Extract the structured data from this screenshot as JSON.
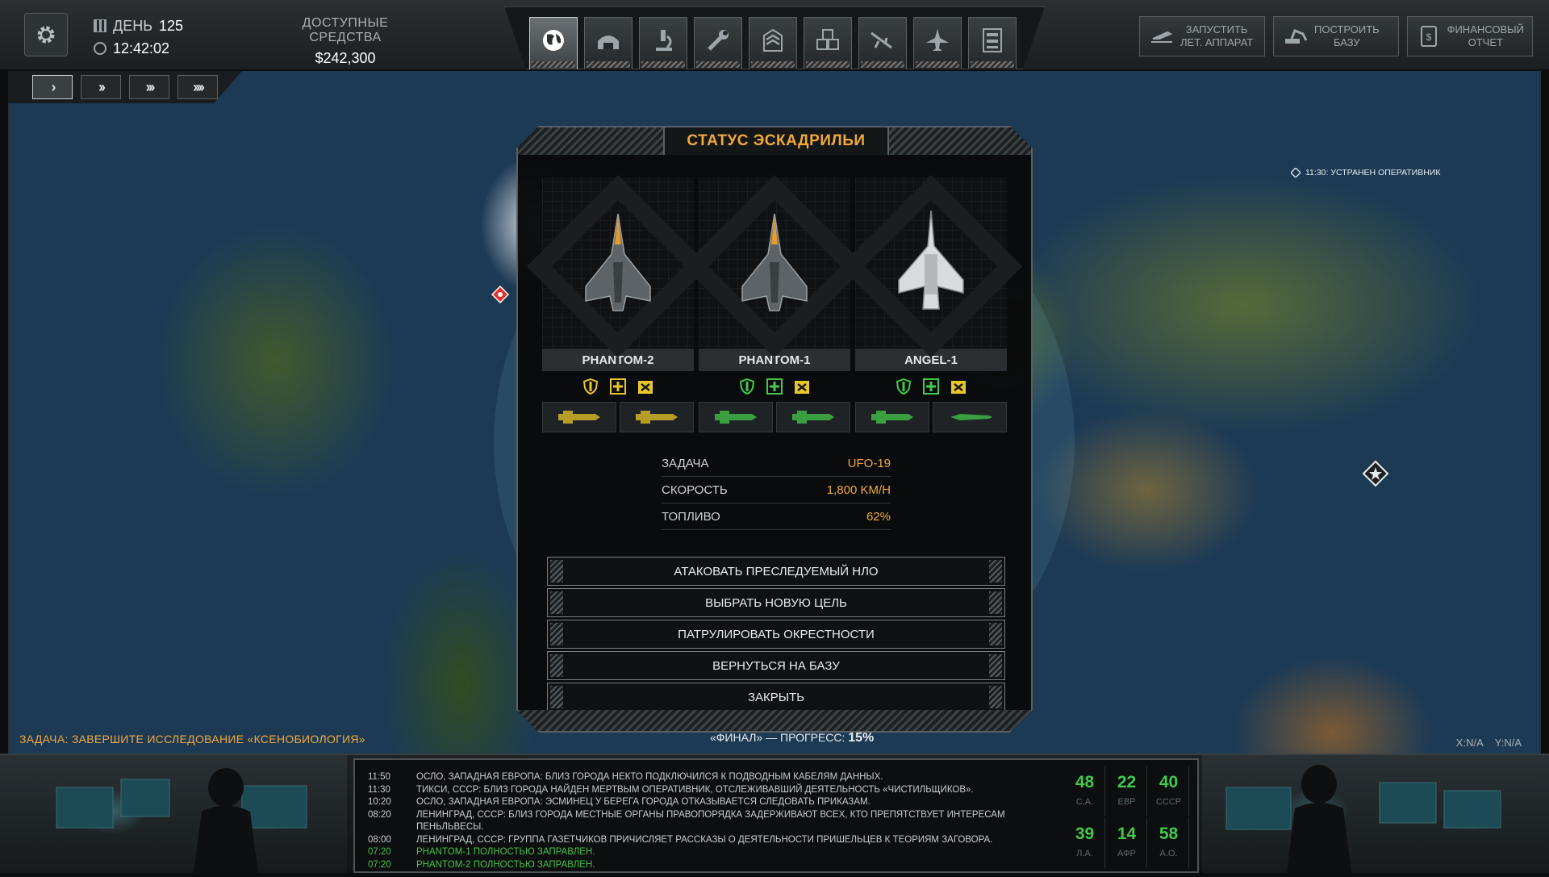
{
  "hud": {
    "day_label": "ДЕНЬ",
    "day_value": "125",
    "time": "12:42:02",
    "funds_label": "ДОСТУПНЫЕ СРЕДСТВА",
    "funds_value": "$242,300"
  },
  "nav_tabs": [
    {
      "icon": "globe-icon",
      "active": true
    },
    {
      "icon": "hangar-icon"
    },
    {
      "icon": "microscope-icon"
    },
    {
      "icon": "wrench-icon"
    },
    {
      "icon": "rank-chevron-icon"
    },
    {
      "icon": "stores-icon"
    },
    {
      "icon": "rifle-icon"
    },
    {
      "icon": "jet-icon"
    },
    {
      "icon": "archive-icon"
    }
  ],
  "actions": {
    "launch": "ЗАПУСТИТЬ\nЛЕТ. АППАРАТ",
    "build": "ПОСТРОИТЬ\nБАЗУ",
    "finance": "ФИНАНСОВЫЙ\nОТЧЕТ"
  },
  "map": {
    "notification": "11:30: УСТРАНЕН ОПЕРАТИВНИК"
  },
  "dialog": {
    "title": "СТАТУС ЭСКАДРИЛЬИ",
    "aircraft": [
      {
        "name": "PHANTOM-2",
        "status_color": "#e8c72a"
      },
      {
        "name": "PHANTOM-1",
        "status_color": "#43c94b"
      },
      {
        "name": "ANGEL-1",
        "status_color": "#43c94b"
      }
    ],
    "info": [
      {
        "key": "ЗАДАЧА",
        "value": "UFO-19"
      },
      {
        "key": "СКОРОСТЬ",
        "value": "1,800 KM/H"
      },
      {
        "key": "ТОПЛИВО",
        "value": "62%"
      }
    ],
    "commands": [
      "АТАКОВАТЬ ПРЕСЛЕДУЕМЫЙ НЛО",
      "ВЫБРАТЬ НОВУЮ ЦЕЛЬ",
      "ПАТРУЛИРОВАТЬ ОКРЕСТНОСТИ",
      "ВЕРНУТЬСЯ НА БАЗУ",
      "ЗАКРЫТЬ"
    ]
  },
  "status_line": {
    "task": "ЗАДАЧА: ЗАВЕРШИТЕ ИССЛЕДОВАНИЕ «КСЕНОБИОЛОГИЯ»",
    "progress_label": "«ФИНАЛ» — ПРОГРЕСС:",
    "progress_value": "15%",
    "x": "X:N/A",
    "y": "Y:N/A"
  },
  "log": [
    {
      "time": "11:50",
      "msg": "ОСЛО, ЗАПАДНАЯ ЕВРОПА: БЛИЗ ГОРОДА НЕКТО ПОДКЛЮЧИЛСЯ К ПОДВОДНЫМ КАБЕЛЯМ ДАННЫХ."
    },
    {
      "time": "11:30",
      "msg": "ТИКСИ, СССР: БЛИЗ ГОРОДА НАЙДЕН МЕРТВЫМ ОПЕРАТИВНИК, ОТСЛЕЖИВАВШИЙ ДЕЯТЕЛЬНОСТЬ «ЧИСТИЛЬЩИКОВ»."
    },
    {
      "time": "10:20",
      "msg": "ОСЛО, ЗАПАДНАЯ ЕВРОПА: ЭСМИНЕЦ У БЕРЕГА ГОРОДА ОТКАЗЫВАЕТСЯ СЛЕДОВАТЬ ПРИКАЗАМ."
    },
    {
      "time": "08:20",
      "msg": "ЛЕНИНГРАД, СССР: БЛИЗ ГОРОДА МЕСТНЫЕ ОРГАНЫ ПРАВОПОРЯДКА ЗАДЕРЖИВАЮТ ВСЕХ, КТО ПРЕПЯТСТВУЕТ ИНТЕРЕСАМ"
    },
    {
      "time": "",
      "msg": "ПЕНЬЛЬВЕСЫ."
    },
    {
      "time": "08:00",
      "msg": "ЛЕНИНГРАД, СССР: ГРУППА ГАЗЕТЧИКОВ ПРИЧИСЛЯЕТ РАССКАЗЫ О ДЕЯТЕЛЬНОСТИ ПРИШЕЛЬЦЕВ К ТЕОРИЯМ ЗАГОВОРА."
    },
    {
      "time": "07:20",
      "msg": "PHANTOM-1 ПОЛНОСТЬЮ ЗАПРАВЛЕН.",
      "green": true
    },
    {
      "time": "07:20",
      "msg": "PHANTOM-2 ПОЛНОСТЬЮ ЗАПРАВЛЕН.",
      "green": true
    }
  ],
  "panic": [
    {
      "value": "48",
      "region": "С.А."
    },
    {
      "value": "22",
      "region": "ЕВР"
    },
    {
      "value": "40",
      "region": "СССР"
    },
    {
      "value": "39",
      "region": "Л.А."
    },
    {
      "value": "14",
      "region": "АФР"
    },
    {
      "value": "58",
      "region": "А.О."
    }
  ]
}
